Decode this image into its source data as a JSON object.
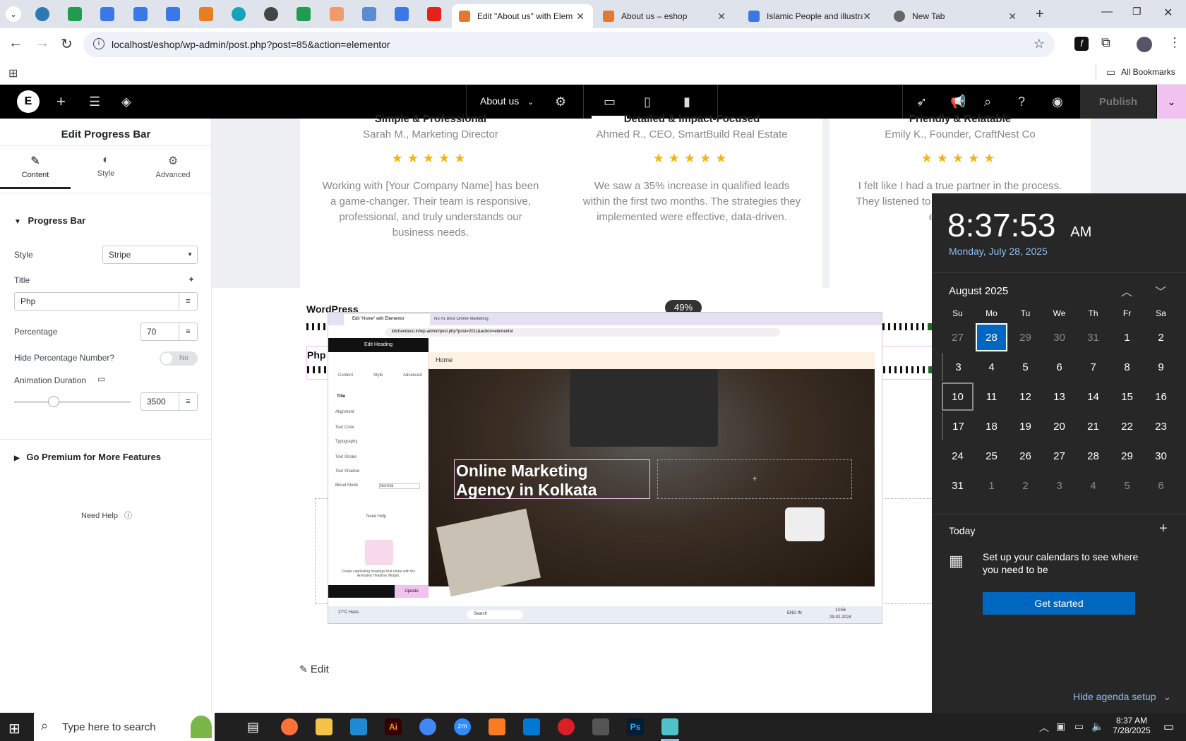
{
  "browser": {
    "tabs": [
      {
        "title": "Edit \"About us\" with Elem",
        "active": true
      },
      {
        "title": "About us – eshop",
        "active": false
      },
      {
        "title": "Islamic People and illustra",
        "active": false
      },
      {
        "title": "New Tab",
        "active": false
      }
    ],
    "url": "localhost/eshop/wp-admin/post.php?post=85&action=elementor",
    "bookmarks_label": "All Bookmarks"
  },
  "elementor": {
    "page_selector": "About us",
    "publish_label": "Publish"
  },
  "panel": {
    "title": "Edit Progress Bar",
    "tabs": [
      "Content",
      "Style",
      "Advanced"
    ],
    "section_title": "Progress Bar",
    "style_label": "Style",
    "style_value": "Stripe",
    "title_label": "Title",
    "title_value": "Php",
    "percentage_label": "Percentage",
    "percentage_value": "70",
    "hide_percentage_label": "Hide Percentage Number?",
    "hide_percentage_toggle": "No",
    "animation_label": "Animation Duration",
    "animation_value": "3500",
    "premium_section": "Go Premium for More Features",
    "need_help": "Need Help"
  },
  "canvas": {
    "cards": [
      {
        "heading": "Simple & Professional",
        "author": "Sarah M., Marketing Director",
        "text": "Working with [Your Company Name] has been a game-changer. Their team is responsive, professional, and truly understands our business needs."
      },
      {
        "heading": "Detailed & Impact-Focused",
        "author": "Ahmed R., CEO, SmartBuild Real Estate",
        "text": "We saw a 35% increase in qualified leads within the first two months. The strategies they implemented were effective, data-driven."
      },
      {
        "heading": "Friendly & Relatable",
        "author": "Emily K., Founder, CraftNest Co",
        "text": "I felt like I had a true partner in the process. They listened to our feedback and exceeded expectations."
      }
    ],
    "stars": "★★★★★",
    "progress_wordpress_label": "WordPress",
    "progress_wordpress_percent": "49%",
    "progress_php_label": "Php",
    "edit_link": "Edit",
    "embedded_screenshot": {
      "tab1": "Edit \"Home\" with Elementor",
      "tab2": "No #1 Best Online Marketing",
      "url": "kitchendeco.in/wp-admin/post.php?post=2011&action=elementor",
      "panel_title": "Edit Heading",
      "panel_tabs": [
        "Content",
        "Style",
        "Advanced"
      ],
      "section": "Title",
      "rows": [
        "Alignment",
        "Text Color",
        "Typography",
        "Text Stroke",
        "Text Shadow",
        "Blend Mode"
      ],
      "blend_value": "Normal",
      "need_help": "Need Help",
      "promo_text": "Create captivating headings that rotate with the Animated Headline Widget.",
      "update_label": "Update",
      "nav_item": "Home",
      "hero_heading_line1": "Online Marketing",
      "hero_heading_line2": "Agency in Kolkata",
      "taskbar_search": "Search",
      "weather": "27°C Haze",
      "tray_time": "13:56",
      "tray_date": "29-02-2024",
      "lang": "ENG IN"
    }
  },
  "clock": {
    "time": "8:37:53",
    "ampm": "AM",
    "date": "Monday, July 28, 2025",
    "month": "August 2025",
    "weekdays": [
      "Su",
      "Mo",
      "Tu",
      "We",
      "Th",
      "Fr",
      "Sa"
    ],
    "days": [
      [
        "27",
        "28",
        "29",
        "30",
        "31",
        "1",
        "2"
      ],
      [
        "3",
        "4",
        "5",
        "6",
        "7",
        "8",
        "9"
      ],
      [
        "10",
        "11",
        "12",
        "13",
        "14",
        "15",
        "16"
      ],
      [
        "17",
        "18",
        "19",
        "20",
        "21",
        "22",
        "23"
      ],
      [
        "24",
        "25",
        "26",
        "27",
        "28",
        "29",
        "30"
      ],
      [
        "31",
        "1",
        "2",
        "3",
        "4",
        "5",
        "6"
      ]
    ],
    "today_label": "Today",
    "agenda_text": "Set up your calendars to see where you need to be",
    "get_started": "Get started",
    "hide_agenda": "Hide agenda setup"
  },
  "taskbar": {
    "search_placeholder": "Type here to search",
    "time": "8:37 AM",
    "date": "7/28/2025"
  },
  "colors": {
    "elementor_pink": "#f1c1f0",
    "calendar_selected": "#0067c0",
    "progress_green": "#1f6b25",
    "star": "#f6b40e"
  }
}
